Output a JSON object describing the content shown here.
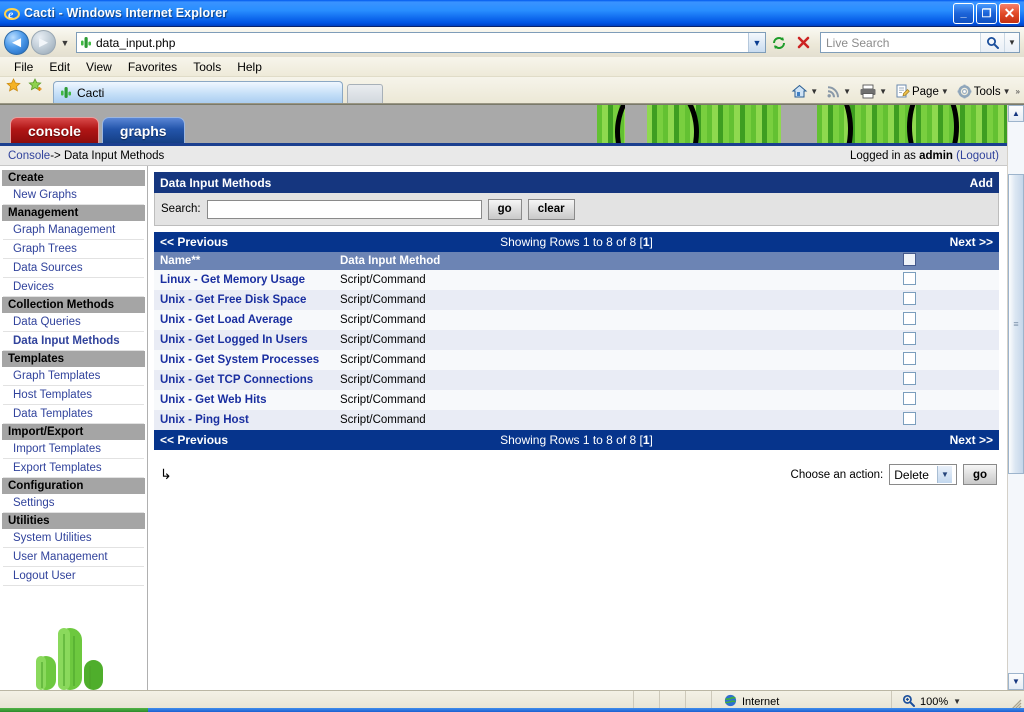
{
  "window": {
    "title": "Cacti - Windows Internet Explorer",
    "title_icon": "ie-logo-icon",
    "minimize_label": "_",
    "restore_label": "❐",
    "close_label": "✕"
  },
  "navbar": {
    "back_label": "◄",
    "forward_label": "►",
    "history_caret": "▼",
    "address_value": "data_input.php",
    "address_icon": "cactus-favicon",
    "address_caret": "▼",
    "refresh_icon": "refresh-icon",
    "stop_icon": "stop-icon",
    "search_placeholder": "Live Search",
    "search_icon": "magnifier-icon",
    "search_caret": "▼"
  },
  "menubar": {
    "items": [
      {
        "label": "File",
        "accel": "F"
      },
      {
        "label": "Edit",
        "accel": "E"
      },
      {
        "label": "View",
        "accel": "V"
      },
      {
        "label": "Favorites",
        "accel": "a"
      },
      {
        "label": "Tools",
        "accel": "T"
      },
      {
        "label": "Help",
        "accel": "H"
      }
    ]
  },
  "cmdbar": {
    "favorites_center_icon": "star-icon",
    "add_favorite_icon": "star-plus-icon",
    "tab_label": "Cacti",
    "tab_icon": "cactus-favicon",
    "new_tab_label": "",
    "buttons": [
      {
        "name": "home",
        "label": "",
        "icon": "home-icon",
        "caret": "▼"
      },
      {
        "name": "feeds",
        "label": "",
        "icon": "rss-icon",
        "caret": "▼"
      },
      {
        "name": "print",
        "label": "",
        "icon": "printer-icon",
        "caret": "▼"
      },
      {
        "name": "page",
        "label": "Page",
        "icon": "page-icon",
        "caret": "▼"
      },
      {
        "name": "tools",
        "label": "Tools",
        "icon": "gear-icon",
        "caret": "▼"
      }
    ],
    "overflow": "»"
  },
  "cacti": {
    "tabs": [
      {
        "id": "console",
        "label": "console",
        "active": true
      },
      {
        "id": "graphs",
        "label": "graphs",
        "active": false
      }
    ],
    "breadcrumb": {
      "root": "Console",
      "rest": " -> Data Input Methods"
    },
    "login": {
      "prefix": "Logged in as ",
      "user": "admin",
      "logout": "(Logout)"
    },
    "sidebar": [
      {
        "type": "header",
        "label": "Create"
      },
      {
        "type": "link",
        "label": "New Graphs",
        "active": false
      },
      {
        "type": "header",
        "label": "Management"
      },
      {
        "type": "link",
        "label": "Graph Management",
        "active": false
      },
      {
        "type": "link",
        "label": "Graph Trees",
        "active": false
      },
      {
        "type": "link",
        "label": "Data Sources",
        "active": false
      },
      {
        "type": "link",
        "label": "Devices",
        "active": false
      },
      {
        "type": "header",
        "label": "Collection Methods"
      },
      {
        "type": "link",
        "label": "Data Queries",
        "active": false
      },
      {
        "type": "link",
        "label": "Data Input Methods",
        "active": true
      },
      {
        "type": "header",
        "label": "Templates"
      },
      {
        "type": "link",
        "label": "Graph Templates",
        "active": false
      },
      {
        "type": "link",
        "label": "Host Templates",
        "active": false
      },
      {
        "type": "link",
        "label": "Data Templates",
        "active": false
      },
      {
        "type": "header",
        "label": "Import/Export"
      },
      {
        "type": "link",
        "label": "Import Templates",
        "active": false
      },
      {
        "type": "link",
        "label": "Export Templates",
        "active": false
      },
      {
        "type": "header",
        "label": "Configuration"
      },
      {
        "type": "link",
        "label": "Settings",
        "active": false
      },
      {
        "type": "header",
        "label": "Utilities"
      },
      {
        "type": "link",
        "label": "System Utilities",
        "active": false
      },
      {
        "type": "link",
        "label": "User Management",
        "active": false
      },
      {
        "type": "link",
        "label": "Logout User",
        "active": false
      }
    ],
    "panel": {
      "title": "Data Input Methods",
      "add_label": "Add",
      "search_label": "Search:",
      "search_value": "",
      "go_label": "go",
      "clear_label": "clear"
    },
    "pager": {
      "previous": "<< Previous",
      "showing": "Showing Rows 1 to 8 of 8 [",
      "page": "1",
      "showing_suffix": "]",
      "next": "Next >>"
    },
    "columns": {
      "name": "Name**",
      "method": "Data Input Method"
    },
    "rows": [
      {
        "name": "Linux - Get Memory Usage",
        "method": "Script/Command"
      },
      {
        "name": "Unix - Get Free Disk Space",
        "method": "Script/Command"
      },
      {
        "name": "Unix - Get Load Average",
        "method": "Script/Command"
      },
      {
        "name": "Unix - Get Logged In Users",
        "method": "Script/Command"
      },
      {
        "name": "Unix - Get System Processes",
        "method": "Script/Command"
      },
      {
        "name": "Unix - Get TCP Connections",
        "method": "Script/Command"
      },
      {
        "name": "Unix - Get Web Hits",
        "method": "Script/Command"
      },
      {
        "name": "Unix - Ping Host",
        "method": "Script/Command"
      }
    ],
    "actions": {
      "corner_icon": "↳",
      "label": "Choose an action:",
      "selected": "Delete",
      "caret": "▼",
      "go_label": "go"
    }
  },
  "scrollbar": {
    "up": "▲",
    "down": "▼",
    "grip": "≡"
  },
  "statusbar": {
    "zone_icon": "globe-icon",
    "zone_label": "Internet",
    "zoom_icon": "zoom-icon",
    "zoom_label": "100%",
    "zoom_caret": "▼"
  },
  "colors": {
    "title_blue": "#0058ee",
    "panel_navy": "#15367f",
    "pager_navy": "#06348c",
    "column_blue": "#6c84b4",
    "link_navy": "#1a2fa0",
    "sidebar_header_gray": "#a5a5a5",
    "console_tab_red": "#b01515",
    "graphs_tab_blue": "#2355aa"
  }
}
